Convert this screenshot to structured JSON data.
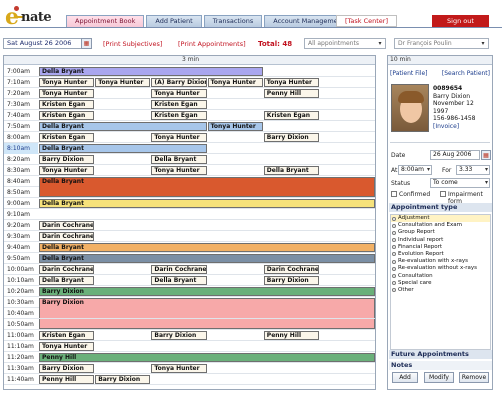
{
  "logo": {
    "text_e": "e",
    "text_nate": "nate"
  },
  "nav": {
    "tabs": [
      "Appointment Book",
      "Add Patient",
      "Transactions",
      "Account Management"
    ],
    "task_center": "[Task Center]",
    "sign_out": "Sign out"
  },
  "toolbar": {
    "date": "Sat August 26 2006",
    "print_subjectives": "[Print Subjectives]",
    "print_appointments": "[Print Appointments]",
    "total": "Total: 48",
    "filter": "All appointments",
    "doctor": "Dr François Poulin"
  },
  "schedule": {
    "header": "3 min",
    "rows": [
      {
        "time": "7:00am",
        "appts": [
          {
            "name": "Della Bryant",
            "col": 0,
            "span": 4,
            "color": "#a9a6ef"
          }
        ]
      },
      {
        "time": "7:10am",
        "appts": [
          {
            "name": "Tonya Hunter",
            "col": 0,
            "color": "#fbf6ea"
          },
          {
            "name": "Tonya Hunter",
            "col": 1,
            "color": "#fbf6ea"
          },
          {
            "name": "(A) Barry Dixion",
            "col": 2,
            "color": "#fbf6ea"
          },
          {
            "name": "Tonya Hunter",
            "col": 3,
            "color": "#fbf6ea"
          },
          {
            "name": "Tonya Hunter",
            "col": 4,
            "color": "#fbf6ea"
          }
        ]
      },
      {
        "time": "7:20am",
        "appts": [
          {
            "name": "Tonya Hunter",
            "col": 0,
            "color": "#fbf6ea"
          },
          {
            "name": "Tonya Hunter",
            "col": 2,
            "color": "#fbf6ea"
          },
          {
            "name": "Penny Hill",
            "col": 4,
            "color": "#fbf6ea"
          }
        ]
      },
      {
        "time": "7:30am",
        "appts": [
          {
            "name": "Kristen Egan",
            "col": 0,
            "color": "#fbf6ea"
          },
          {
            "name": "Kristen Egan",
            "col": 2,
            "color": "#fbf6ea"
          }
        ]
      },
      {
        "time": "7:40am",
        "appts": [
          {
            "name": "Kristen Egan",
            "col": 0,
            "color": "#fbf6ea"
          },
          {
            "name": "Kristen Egan",
            "col": 2,
            "color": "#fbf6ea"
          },
          {
            "name": "Kristen Egan",
            "col": 4,
            "color": "#fbf6ea"
          }
        ]
      },
      {
        "time": "7:50am",
        "appts": [
          {
            "name": "Della Bryant",
            "col": 0,
            "span": 3,
            "color": "#a7c6ea"
          },
          {
            "name": "Tonya Hunter",
            "col": 3,
            "color": "#a7c6ea"
          }
        ]
      },
      {
        "time": "8:00am",
        "appts": [
          {
            "name": "Kristen Egan",
            "col": 0,
            "color": "#fbf6ea"
          },
          {
            "name": "Tonya Hunter",
            "col": 2,
            "color": "#fbf6ea"
          },
          {
            "name": "Barry Dixion",
            "col": 4,
            "color": "#fbf6ea"
          }
        ]
      },
      {
        "time": "8:10am",
        "highlight": true,
        "appts": [
          {
            "name": "Della Bryant",
            "col": 0,
            "span": 3,
            "color": "#a7c6ea"
          }
        ]
      },
      {
        "time": "8:20am",
        "appts": [
          {
            "name": "Barry Dixion",
            "col": 0,
            "color": "#fbf6ea"
          },
          {
            "name": "Della Bryant",
            "col": 2,
            "color": "#fbf6ea"
          }
        ]
      },
      {
        "time": "8:30am",
        "appts": [
          {
            "name": "Tonya Hunter",
            "col": 0,
            "color": "#fbf6ea"
          },
          {
            "name": "Tonya Hunter",
            "col": 2,
            "color": "#fbf6ea"
          },
          {
            "name": "Della Bryant",
            "col": 4,
            "color": "#fbf6ea"
          }
        ]
      },
      {
        "time": "8:40am",
        "appts": [
          {
            "name": "Della Bryant",
            "col": 0,
            "span": 6,
            "rows": 2,
            "color": "#d9592e"
          }
        ]
      },
      {
        "time": "8:50am",
        "appts": []
      },
      {
        "time": "9:00am",
        "appts": [
          {
            "name": "Della Bryant",
            "col": 0,
            "span": 6,
            "color": "#f6e27b"
          }
        ]
      },
      {
        "time": "9:10am",
        "appts": []
      },
      {
        "time": "9:20am",
        "appts": [
          {
            "name": "Darin Cochrane",
            "col": 0,
            "color": "#fbf6ea"
          }
        ]
      },
      {
        "time": "9:30am",
        "appts": [
          {
            "name": "Darin Cochrane",
            "col": 0,
            "color": "#fbf6ea"
          }
        ]
      },
      {
        "time": "9:40am",
        "appts": [
          {
            "name": "Della Bryant",
            "col": 0,
            "span": 6,
            "color": "#f2b166"
          }
        ]
      },
      {
        "time": "9:50am",
        "appts": [
          {
            "name": "Della Bryant",
            "col": 0,
            "span": 6,
            "color": "#7b8fa5"
          }
        ]
      },
      {
        "time": "10:00am",
        "appts": [
          {
            "name": "Darin Cochrane",
            "col": 0,
            "color": "#fbf6ea"
          },
          {
            "name": "Darin Cochrane",
            "col": 2,
            "color": "#fbf6ea"
          },
          {
            "name": "Darin Cochrane",
            "col": 4,
            "color": "#fbf6ea"
          }
        ]
      },
      {
        "time": "10:10am",
        "appts": [
          {
            "name": "Della Bryant",
            "col": 0,
            "color": "#fbf6ea"
          },
          {
            "name": "Della Bryant",
            "col": 2,
            "color": "#fbf6ea"
          },
          {
            "name": "Barry Dixion",
            "col": 4,
            "color": "#fbf6ea"
          }
        ]
      },
      {
        "time": "10:20am",
        "appts": [
          {
            "name": "Barry Dixion",
            "col": 0,
            "span": 6,
            "color": "#6ab07a"
          }
        ]
      },
      {
        "time": "10:30am",
        "appts": [
          {
            "name": "Barry Dixion",
            "col": 0,
            "span": 6,
            "rows": 3,
            "color": "#f7a9a9"
          }
        ]
      },
      {
        "time": "10:40am",
        "appts": []
      },
      {
        "time": "10:50am",
        "appts": []
      },
      {
        "time": "11:00am",
        "appts": [
          {
            "name": "Kristen Egan",
            "col": 0,
            "color": "#fbf6ea"
          },
          {
            "name": "Barry Dixion",
            "col": 2,
            "color": "#fbf6ea"
          },
          {
            "name": "Penny Hill",
            "col": 4,
            "color": "#fbf6ea"
          }
        ]
      },
      {
        "time": "11:10am",
        "appts": [
          {
            "name": "Tonya Hunter",
            "col": 0,
            "color": "#fbf6ea"
          }
        ]
      },
      {
        "time": "11:20am",
        "appts": [
          {
            "name": "Penny Hill",
            "col": 0,
            "span": 6,
            "color": "#6ab07a"
          }
        ]
      },
      {
        "time": "11:30am",
        "appts": [
          {
            "name": "Barry Dixion",
            "col": 0,
            "color": "#fbf6ea"
          },
          {
            "name": "Tonya Hunter",
            "col": 2,
            "color": "#fbf6ea"
          }
        ]
      },
      {
        "time": "11:40am",
        "appts": [
          {
            "name": "Penny Hill",
            "col": 0,
            "color": "#fbf6ea"
          },
          {
            "name": "Barry Dixion",
            "col": 1,
            "color": "#fbf6ea"
          }
        ]
      }
    ]
  },
  "patient": {
    "header": "10 min",
    "file_link": "[Patient File]",
    "search_link": "[Search Patient]",
    "id": "0089654",
    "name": "Barry Dixion",
    "dob_line1": "November 12",
    "dob_line2": "1997",
    "phone": "156-986-1458",
    "invoice": "[Invoice]",
    "date_label": "Date",
    "date_value": "26 Aug 2006",
    "at_label": "At",
    "at_value": "8:00am",
    "for_label": "For",
    "for_value": "3.33",
    "status_label": "Status",
    "status_value": "To come",
    "confirmed_label": "Confirmed",
    "impairment_label": "Impairment form",
    "appt_type_title": "Appointment type",
    "appt_types": [
      "Adjustment",
      "Consultation and Exam",
      "Group Report",
      "Individual report",
      "Financial Report",
      "Evolution Report",
      "Re-evaluation with x-rays",
      "Re-evaluation without x-rays",
      "Consultation",
      "Special care",
      "Other"
    ],
    "future_title": "Future Appointments",
    "notes_title": "Notes",
    "buttons": [
      "Add",
      "Modify",
      "Remove"
    ]
  }
}
